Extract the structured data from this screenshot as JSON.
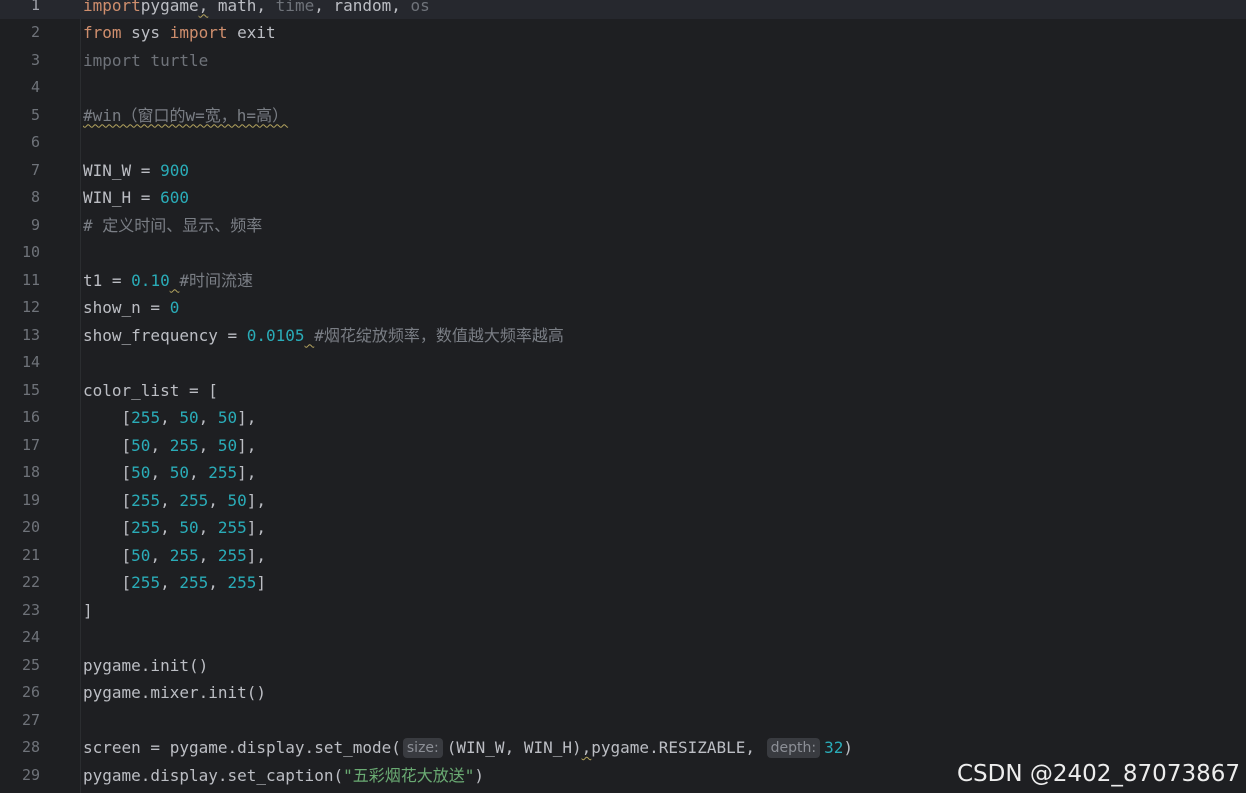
{
  "lines": [
    {
      "n": "1",
      "parts": [
        [
          "kw",
          "import"
        ],
        [
          "",
          "pygame"
        ],
        [
          "squiggle",
          ","
        ],
        [
          "",
          " math, "
        ],
        [
          "unused",
          "time"
        ],
        [
          "",
          ", random, "
        ],
        [
          "unused",
          "os"
        ]
      ]
    },
    {
      "n": "2",
      "parts": [
        [
          "kw",
          "from"
        ],
        [
          "",
          " sys "
        ],
        [
          "kw",
          "import"
        ],
        [
          "",
          " exit"
        ]
      ]
    },
    {
      "n": "3",
      "parts": [
        [
          "unused",
          "import turtle"
        ]
      ]
    },
    {
      "n": "4",
      "parts": []
    },
    {
      "n": "5",
      "parts": [
        [
          "cmt squiggle",
          "#win（窗口的w=宽，h=高）"
        ]
      ]
    },
    {
      "n": "6",
      "parts": []
    },
    {
      "n": "7",
      "parts": [
        [
          "",
          "WIN_W = "
        ],
        [
          "num",
          "900"
        ]
      ]
    },
    {
      "n": "8",
      "parts": [
        [
          "",
          "WIN_H = "
        ],
        [
          "num",
          "600"
        ]
      ]
    },
    {
      "n": "9",
      "parts": [
        [
          "cmt",
          "# 定义时间、显示、频率"
        ]
      ]
    },
    {
      "n": "10",
      "parts": []
    },
    {
      "n": "11",
      "parts": [
        [
          "",
          "t1 = "
        ],
        [
          "num",
          "0.10"
        ],
        [
          "squiggle",
          " "
        ],
        [
          "cmt",
          "#时间流速"
        ]
      ]
    },
    {
      "n": "12",
      "parts": [
        [
          "",
          "show_n = "
        ],
        [
          "num",
          "0"
        ]
      ]
    },
    {
      "n": "13",
      "parts": [
        [
          "",
          "show_frequency = "
        ],
        [
          "num",
          "0.0105"
        ],
        [
          "squiggle",
          " "
        ],
        [
          "cmt",
          "#烟花绽放频率，数值越大频率越高"
        ]
      ]
    },
    {
      "n": "14",
      "parts": []
    },
    {
      "n": "15",
      "parts": [
        [
          "",
          "color_list = ["
        ]
      ]
    },
    {
      "n": "16",
      "parts": [
        [
          "",
          "    ["
        ],
        [
          "num",
          "255"
        ],
        [
          "",
          ", "
        ],
        [
          "num",
          "50"
        ],
        [
          "",
          ", "
        ],
        [
          "num",
          "50"
        ],
        [
          "",
          "],"
        ]
      ]
    },
    {
      "n": "17",
      "parts": [
        [
          "",
          "    ["
        ],
        [
          "num",
          "50"
        ],
        [
          "",
          ", "
        ],
        [
          "num",
          "255"
        ],
        [
          "",
          ", "
        ],
        [
          "num",
          "50"
        ],
        [
          "",
          "],"
        ]
      ]
    },
    {
      "n": "18",
      "parts": [
        [
          "",
          "    ["
        ],
        [
          "num",
          "50"
        ],
        [
          "",
          ", "
        ],
        [
          "num",
          "50"
        ],
        [
          "",
          ", "
        ],
        [
          "num",
          "255"
        ],
        [
          "",
          "],"
        ]
      ]
    },
    {
      "n": "19",
      "parts": [
        [
          "",
          "    ["
        ],
        [
          "num",
          "255"
        ],
        [
          "",
          ", "
        ],
        [
          "num",
          "255"
        ],
        [
          "",
          ", "
        ],
        [
          "num",
          "50"
        ],
        [
          "",
          "],"
        ]
      ]
    },
    {
      "n": "20",
      "parts": [
        [
          "",
          "    ["
        ],
        [
          "num",
          "255"
        ],
        [
          "",
          ", "
        ],
        [
          "num",
          "50"
        ],
        [
          "",
          ", "
        ],
        [
          "num",
          "255"
        ],
        [
          "",
          "],"
        ]
      ]
    },
    {
      "n": "21",
      "parts": [
        [
          "",
          "    ["
        ],
        [
          "num",
          "50"
        ],
        [
          "",
          ", "
        ],
        [
          "num",
          "255"
        ],
        [
          "",
          ", "
        ],
        [
          "num",
          "255"
        ],
        [
          "",
          "],"
        ]
      ]
    },
    {
      "n": "22",
      "parts": [
        [
          "",
          "    ["
        ],
        [
          "num",
          "255"
        ],
        [
          "",
          ", "
        ],
        [
          "num",
          "255"
        ],
        [
          "",
          ", "
        ],
        [
          "num",
          "255"
        ],
        [
          "",
          "]"
        ]
      ]
    },
    {
      "n": "23",
      "parts": [
        [
          "",
          "]"
        ]
      ]
    },
    {
      "n": "24",
      "parts": []
    },
    {
      "n": "25",
      "parts": [
        [
          "",
          "pygame.init()"
        ]
      ]
    },
    {
      "n": "26",
      "parts": [
        [
          "",
          "pygame.mixer.init()"
        ]
      ]
    },
    {
      "n": "27",
      "parts": []
    },
    {
      "n": "28",
      "parts": [
        [
          "",
          "screen = pygame.display.set_mode("
        ],
        [
          "hint",
          "size:"
        ],
        [
          "",
          "(WIN_W, WIN_H)"
        ],
        [
          "squiggle",
          ","
        ],
        [
          "",
          "pygame.RESIZABLE, "
        ],
        [
          "hint",
          "depth:"
        ],
        [
          "num",
          "32"
        ],
        [
          "",
          ")"
        ]
      ]
    },
    {
      "n": "29",
      "parts": [
        [
          "",
          "pygame.display.set_caption("
        ],
        [
          "str",
          "\"五彩烟花大放送\""
        ],
        [
          "",
          ")"
        ]
      ]
    }
  ],
  "current_line": "1",
  "watermark": "CSDN @2402_87073867"
}
